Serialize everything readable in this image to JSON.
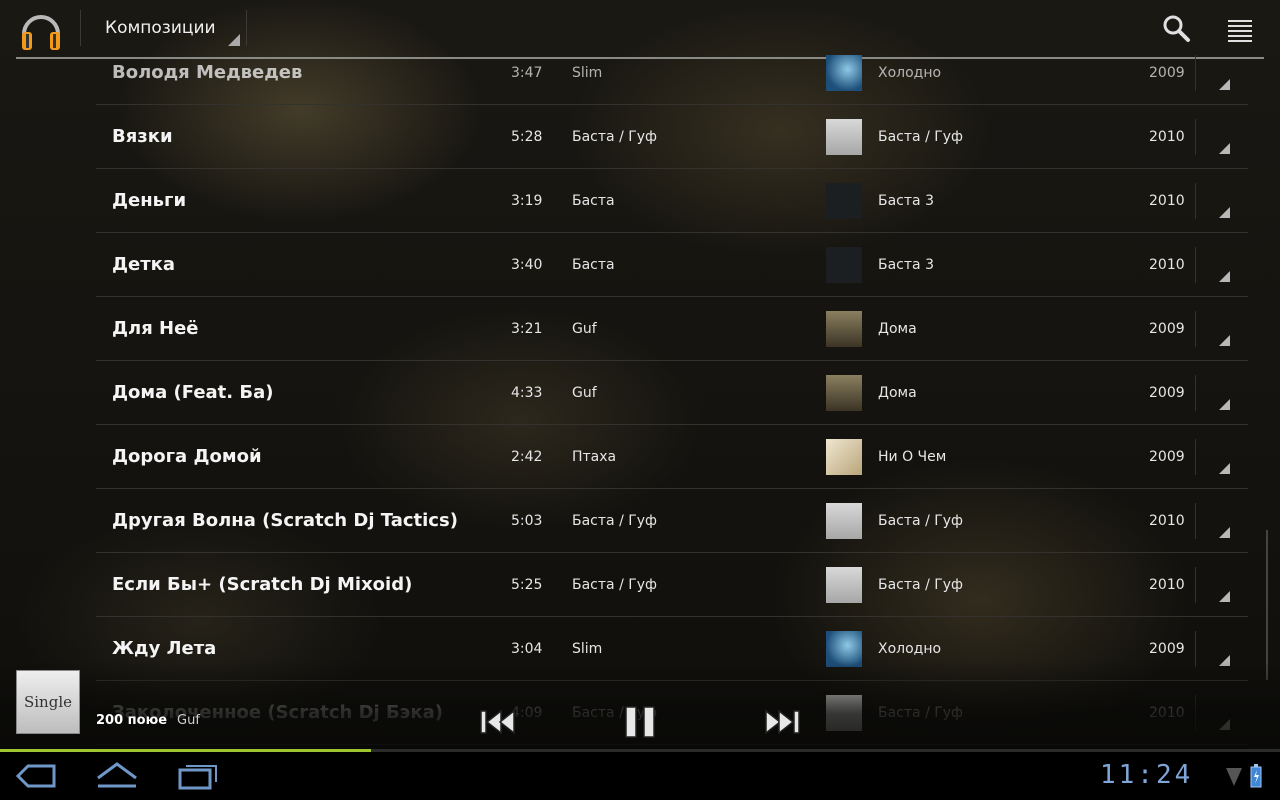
{
  "actionbar": {
    "nav_title": "Композиции",
    "icons": {
      "app": "headphones-icon",
      "search": "search-icon",
      "menu": "list-menu-icon"
    }
  },
  "songs": [
    {
      "title": "Володя Медведев",
      "duration": "3:47",
      "artist": "Slim",
      "album": "Холодно",
      "year": "2009",
      "cover": "slim"
    },
    {
      "title": "Вязки",
      "duration": "5:28",
      "artist": "Баста / Гуф",
      "album": "Баста / Гуф",
      "year": "2010",
      "cover": "bastaguf"
    },
    {
      "title": "Деньги",
      "duration": "3:19",
      "artist": "Баста",
      "album": "Баста 3",
      "year": "2010",
      "cover": "basta3"
    },
    {
      "title": "Детка",
      "duration": "3:40",
      "artist": "Баста",
      "album": "Баста 3",
      "year": "2010",
      "cover": "basta3"
    },
    {
      "title": "Для Неё",
      "duration": "3:21",
      "artist": "Guf",
      "album": "Дома",
      "year": "2009",
      "cover": "doma"
    },
    {
      "title": "Дома (Feat. Ба)",
      "duration": "4:33",
      "artist": "Guf",
      "album": "Дома",
      "year": "2009",
      "cover": "doma"
    },
    {
      "title": "Дорога Домой",
      "duration": "2:42",
      "artist": "Птаха",
      "album": "Ни О Чем",
      "year": "2009",
      "cover": "nioche"
    },
    {
      "title": "Другая Волна (Scratch Dj Tactics)",
      "duration": "5:03",
      "artist": "Баста / Гуф",
      "album": "Баста / Гуф",
      "year": "2010",
      "cover": "bastaguf"
    },
    {
      "title": "Если Бы+ (Scratch Dj Mixoid)",
      "duration": "5:25",
      "artist": "Баста / Гуф",
      "album": "Баста / Гуф",
      "year": "2010",
      "cover": "bastaguf"
    },
    {
      "title": "Жду Лета",
      "duration": "3:04",
      "artist": "Slim",
      "album": "Холодно",
      "year": "2009",
      "cover": "slim"
    },
    {
      "title": "Заколоченное (Scratch Dj Бэка)",
      "duration": "4:09",
      "artist": "Баста / Гуф",
      "album": "Баста / Гуф",
      "year": "2010",
      "cover": "bastaguf"
    }
  ],
  "now_playing": {
    "album_art_text": "Single",
    "title": "200 поюе",
    "artist": "Guf",
    "progress": 0.29
  },
  "controls": {
    "prev": "previous-track-icon",
    "pause": "pause-icon",
    "next": "next-track-icon"
  },
  "systembar": {
    "time": "11:24",
    "back": "back-icon",
    "home": "home-icon",
    "recents": "recent-apps-icon",
    "signal": "signal-icon",
    "battery": "battery-icon"
  }
}
